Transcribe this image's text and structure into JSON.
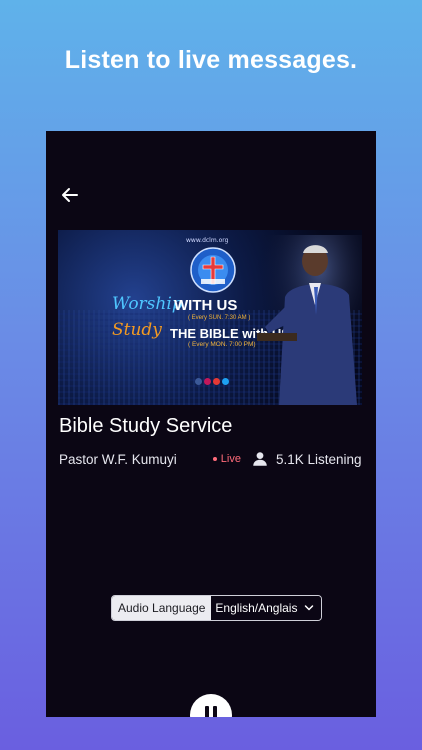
{
  "headline": "Listen to live messages.",
  "screen": {
    "banner": {
      "site_url": "www.dclm.org",
      "worship": "Worship",
      "with_us": "WITH US",
      "sub1": "( Every SUN. 7:30 AM )",
      "study": "Study",
      "bible": "THE BIBLE with US",
      "sub2": "( Every MON. 7:00 PM)"
    },
    "title": "Bible Study Service",
    "preacher": "Pastor W.F. Kumuyi",
    "live_label": "Live",
    "listeners": "5.1K Listening",
    "audio_language_label": "Audio Language",
    "audio_language_value": "English/Anglais",
    "icons": [
      "back-arrow-icon",
      "person-icon",
      "chevron-down-icon",
      "pause-icon"
    ],
    "colors": {
      "live": "#ff6b7a",
      "background": "#0b0614"
    }
  }
}
